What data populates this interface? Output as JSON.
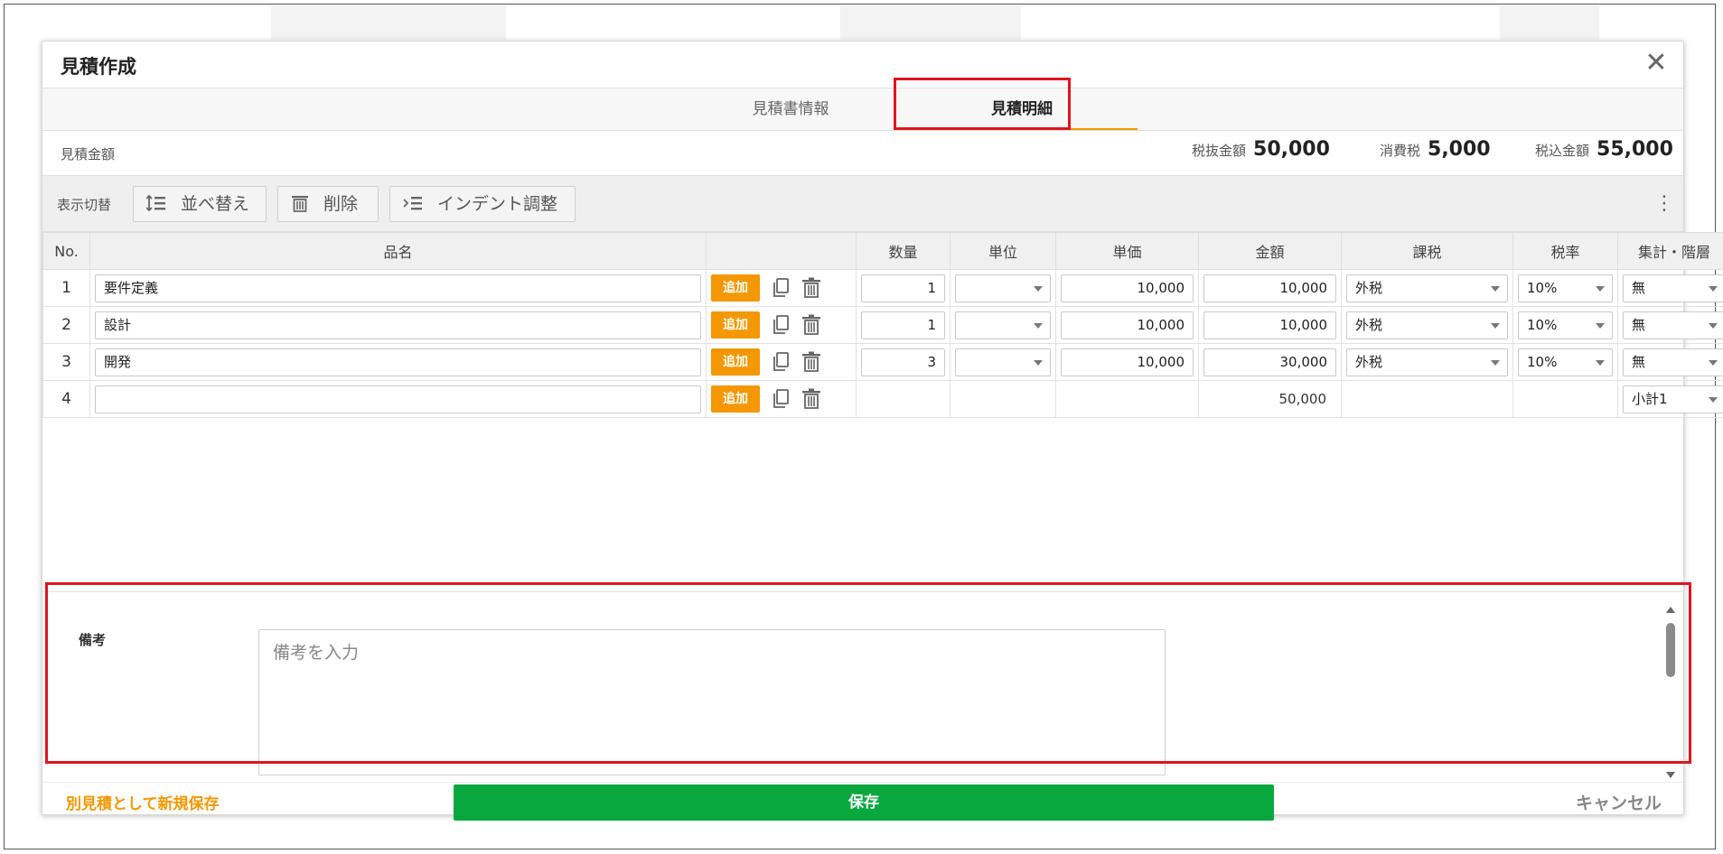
{
  "modal": {
    "title": "見積作成",
    "close_symbol": "✕"
  },
  "tabs": [
    {
      "label": "見積書情報",
      "active": false
    },
    {
      "label": "見積明細",
      "active": true
    }
  ],
  "summary": {
    "label": "見積金額",
    "pre_tax_label": "税抜金額",
    "pre_tax_value": "50,000",
    "tax_label": "消費税",
    "tax_value": "5,000",
    "total_label": "税込金額",
    "total_value": "55,000"
  },
  "toolbar": {
    "display_toggle_label": "表示切替",
    "sort_label": "並べ替え",
    "delete_label": "削除",
    "indent_label": "インデント調整",
    "menu_symbol": "⋮"
  },
  "table": {
    "columns": {
      "no": "No.",
      "item_name": "品名",
      "actions": "",
      "quantity": "数量",
      "unit": "単位",
      "unit_price": "単価",
      "amount": "金額",
      "tax_type": "課税",
      "tax_rate": "税率",
      "aggregate": "集計・階層"
    },
    "add_label": "追加",
    "rows": [
      {
        "no": "1",
        "item_name": "要件定義",
        "quantity": "1",
        "unit": "",
        "unit_price": "10,000",
        "amount": "10,000",
        "tax_type": "外税",
        "tax_rate": "10%",
        "aggregate": "無"
      },
      {
        "no": "2",
        "item_name": "設計",
        "quantity": "1",
        "unit": "",
        "unit_price": "10,000",
        "amount": "10,000",
        "tax_type": "外税",
        "tax_rate": "10%",
        "aggregate": "無"
      },
      {
        "no": "3",
        "item_name": "開発",
        "quantity": "3",
        "unit": "",
        "unit_price": "10,000",
        "amount": "30,000",
        "tax_type": "外税",
        "tax_rate": "10%",
        "aggregate": "無"
      }
    ],
    "subtotal_row": {
      "no": "4",
      "item_name": "",
      "amount": "50,000",
      "aggregate": "小計1"
    }
  },
  "notes": {
    "label": "備考",
    "placeholder": "備考を入力"
  },
  "footer": {
    "save_as_new_label": "別見積として新規保存",
    "save_label": "保存",
    "cancel_label": "キャンセル"
  },
  "colors": {
    "accent_orange": "#f39800",
    "save_green": "#09a83e",
    "highlight_red": "#e0141e"
  }
}
